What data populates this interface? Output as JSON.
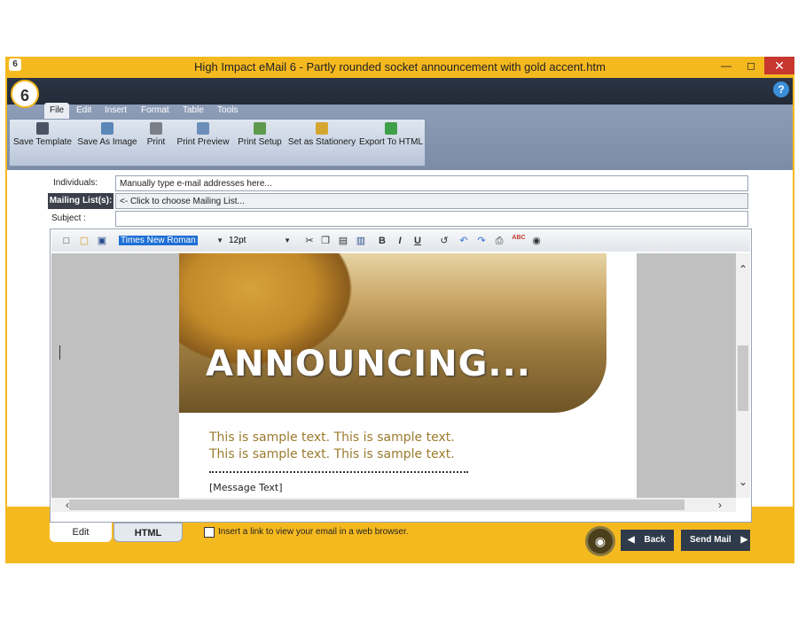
{
  "window": {
    "title": "High Impact eMail 6 - Partly rounded socket announcement with gold accent.htm",
    "minimize_icon": "minimize-icon",
    "maximize_icon": "maximize-icon",
    "close_icon": "close-icon",
    "logo_text": "6",
    "help_text": "?"
  },
  "menu": {
    "tabs": [
      "File",
      "Edit",
      "Insert",
      "Format",
      "Table",
      "Tools"
    ]
  },
  "toolbar": {
    "buttons": [
      {
        "label": "Save Template",
        "icon": "floppy-icon"
      },
      {
        "label": "Save As Image",
        "icon": "image-save-icon"
      },
      {
        "label": "Print",
        "icon": "printer-icon"
      },
      {
        "label": "Print Preview",
        "icon": "print-preview-icon"
      },
      {
        "label": "Print Setup",
        "icon": "print-setup-icon"
      },
      {
        "label": "Set as Stationery",
        "icon": "stationery-icon"
      },
      {
        "label": "Export To HTML",
        "icon": "export-html-icon"
      }
    ]
  },
  "form": {
    "individuals_label": "Individuals:",
    "individuals_value": "Manually type e-mail addresses here...",
    "mailing_label": "Mailing List(s):",
    "mailing_value": "<- Click to choose Mailing List...",
    "subject_label": "Subject :",
    "subject_value": ""
  },
  "editor": {
    "font_name": "Times New Roman",
    "font_size": "12pt",
    "bold": "B",
    "italic": "I",
    "underline": "U",
    "spell": "ABC"
  },
  "document": {
    "hero_text": "ANNOUNCING...",
    "sample_line_1": "This is sample text. This is sample text.",
    "sample_line_2": "This is sample text. This is sample text.",
    "message_placeholder": "[Message Text]"
  },
  "bottom": {
    "tab_edit": "Edit",
    "tab_html": "HTML",
    "checkbox_label": "Insert a link to view your email in a web browser.",
    "back_label": "Back",
    "send_label": "Send Mail"
  },
  "colors": {
    "accent": "#f5b920",
    "ribbon_dark": "#232b38",
    "sample_text": "#9b7b2d"
  }
}
